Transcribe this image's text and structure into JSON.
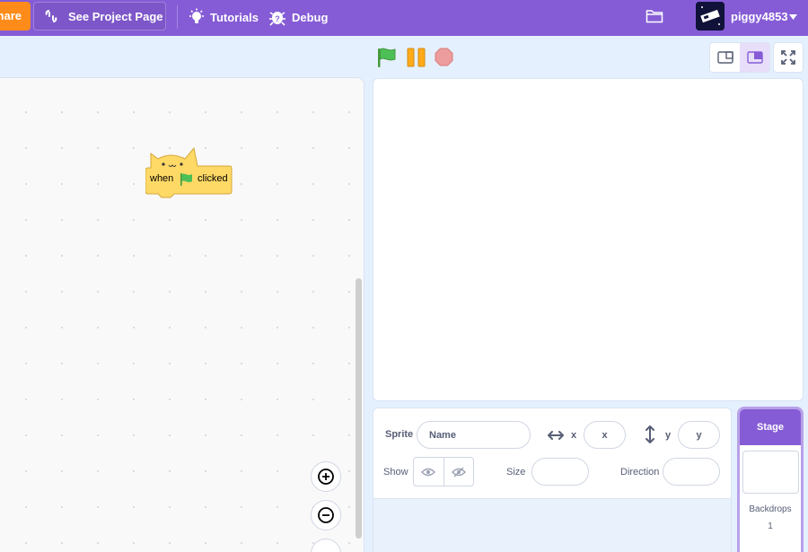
{
  "menubar": {
    "share_label": "hare",
    "project_page_label": "See Project Page",
    "tutorials_label": "Tutorials",
    "debug_label": "Debug",
    "username": "piggy4853"
  },
  "code_area": {
    "hat_block": {
      "when": "when",
      "clicked": "clicked"
    }
  },
  "sprite_info": {
    "sprite_label": "Sprite",
    "name_placeholder": "Name",
    "x_label": "x",
    "x_placeholder": "x",
    "y_label": "y",
    "y_placeholder": "y",
    "show_label": "Show",
    "size_label": "Size",
    "direction_label": "Direction"
  },
  "stage_selector": {
    "header": "Stage",
    "backdrops_label": "Backdrops",
    "backdrops_count": "1"
  },
  "colors": {
    "menubar": "#855cd6",
    "share": "#ff8c1a",
    "green_flag": "#4cbf56",
    "pause": "#ffab19",
    "stop": "#ec9c9c",
    "hat_block": "#ffd966"
  }
}
